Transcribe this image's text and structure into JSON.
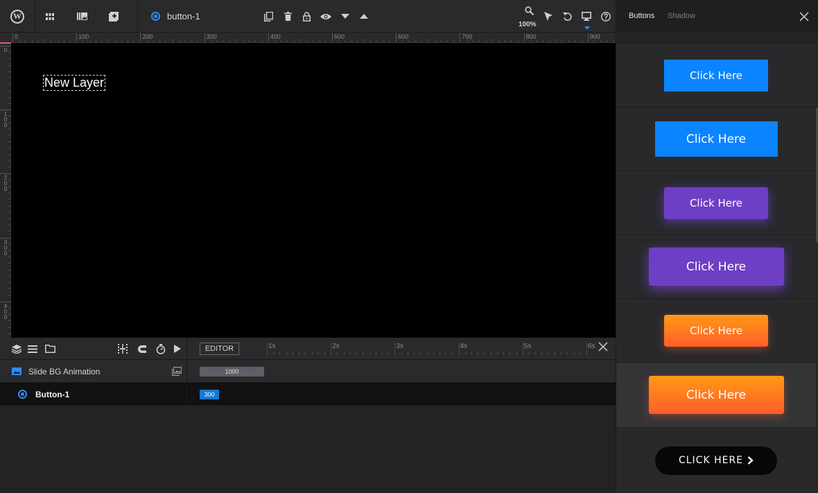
{
  "toolbar": {
    "layer_name": "button-1",
    "zoom": "100%"
  },
  "ruler": {
    "h_labels": [
      "0",
      "100",
      "200",
      "300",
      "400",
      "500",
      "600",
      "700",
      "800",
      "900"
    ],
    "v_labels": [
      "0",
      "100",
      "200",
      "300",
      "400"
    ]
  },
  "canvas": {
    "layer_text": "New Layer",
    "background": "#000000"
  },
  "timeline": {
    "editor_label": "EDITOR",
    "seconds": [
      "1s",
      "2s",
      "3s",
      "4s",
      "5s",
      "6s"
    ],
    "rows": [
      {
        "label": "Slide BG Animation",
        "bar_value": "1000"
      },
      {
        "label": "Button-1",
        "bar_value": "300"
      }
    ]
  },
  "panel": {
    "tabs": [
      "Buttons",
      "Shadow"
    ],
    "presets": [
      {
        "label": "Click Here",
        "color": "#0a84ff"
      },
      {
        "label": "Click Here",
        "color": "#0a84ff"
      },
      {
        "label": "Click Here",
        "color": "#6d3fc4"
      },
      {
        "label": "Click Here",
        "color": "#6d3fc4"
      },
      {
        "label": "Click Here",
        "color": "#ff7a20"
      },
      {
        "label": "Click Here",
        "color": "#ff7a20"
      },
      {
        "label": "CLICK HERE",
        "color": "#070707"
      }
    ]
  },
  "colors": {
    "accent": "#2d8cff",
    "ruler_marker": "#e0558a"
  }
}
